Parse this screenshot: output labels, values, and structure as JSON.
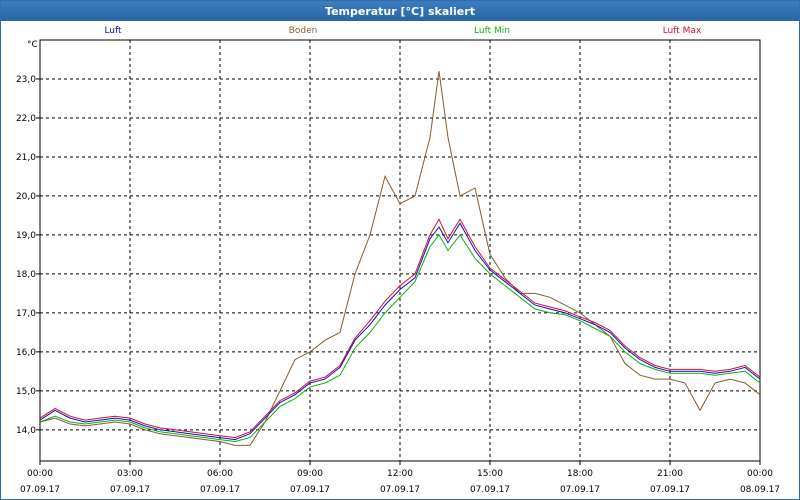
{
  "window": {
    "title": "Temperatur [°C] skaliert"
  },
  "chart_data": {
    "type": "line",
    "title": "Temperatur [°C] skaliert",
    "ylabel": "°C",
    "xlabel": "",
    "xlim": [
      0,
      24
    ],
    "ylim": [
      13.2,
      24.0
    ],
    "yticks": [
      14.0,
      15.0,
      16.0,
      17.0,
      18.0,
      19.0,
      20.0,
      21.0,
      22.0,
      23.0
    ],
    "ytick_labels": [
      "14,0",
      "15,0",
      "16,0",
      "17,0",
      "18,0",
      "19,0",
      "20,0",
      "21,0",
      "22,0",
      "23,0"
    ],
    "xticks": [
      {
        "t": 0,
        "time": "00:00",
        "date": "07.09.17"
      },
      {
        "t": 3,
        "time": "03:00",
        "date": "07.09.17"
      },
      {
        "t": 6,
        "time": "06:00",
        "date": "07.09.17"
      },
      {
        "t": 9,
        "time": "09:00",
        "date": "07.09.17"
      },
      {
        "t": 12,
        "time": "12:00",
        "date": "07.09.17"
      },
      {
        "t": 15,
        "time": "15:00",
        "date": "07.09.17"
      },
      {
        "t": 18,
        "time": "18:00",
        "date": "07.09.17"
      },
      {
        "t": 21,
        "time": "21:00",
        "date": "07.09.17"
      },
      {
        "t": 24,
        "time": "00:00",
        "date": "08.09.17"
      }
    ],
    "grid": true,
    "legend_position": "top",
    "series": [
      {
        "name": "Luft",
        "color": "#1010c0",
        "x": [
          0,
          0.5,
          1,
          1.5,
          2,
          2.5,
          3,
          3.5,
          4,
          4.5,
          5,
          5.5,
          6,
          6.5,
          7,
          7.5,
          8,
          8.5,
          9,
          9.5,
          10,
          10.5,
          11,
          11.5,
          12,
          12.5,
          13,
          13.3,
          13.6,
          14,
          14.5,
          15,
          15.5,
          16,
          16.5,
          17,
          17.5,
          18,
          18.5,
          19,
          19.5,
          20,
          20.5,
          21,
          21.5,
          22,
          22.5,
          23,
          23.5,
          24
        ],
        "y": [
          14.25,
          14.5,
          14.3,
          14.2,
          14.25,
          14.3,
          14.25,
          14.1,
          14.0,
          13.95,
          13.9,
          13.85,
          13.8,
          13.75,
          13.9,
          14.3,
          14.7,
          14.9,
          15.2,
          15.3,
          15.6,
          16.3,
          16.7,
          17.2,
          17.6,
          17.9,
          18.9,
          19.2,
          18.8,
          19.3,
          18.6,
          18.1,
          17.8,
          17.5,
          17.2,
          17.1,
          17.0,
          16.85,
          16.7,
          16.5,
          16.1,
          15.8,
          15.6,
          15.5,
          15.5,
          15.5,
          15.45,
          15.5,
          15.6,
          15.3
        ]
      },
      {
        "name": "Boden",
        "color": "#8b5a2b",
        "x": [
          0,
          0.5,
          1,
          1.5,
          2,
          2.5,
          3,
          3.5,
          4,
          4.5,
          5,
          5.5,
          6,
          6.5,
          7,
          7.5,
          8,
          8.5,
          9,
          9.5,
          10,
          10.5,
          11,
          11.5,
          12,
          12.5,
          13,
          13.3,
          13.6,
          14,
          14.5,
          15,
          15.5,
          16,
          16.5,
          17,
          17.5,
          18,
          18.5,
          19,
          19.5,
          20,
          20.5,
          21,
          21.5,
          22,
          22.5,
          23,
          23.5,
          24
        ],
        "y": [
          14.2,
          14.3,
          14.15,
          14.1,
          14.15,
          14.2,
          14.15,
          14.0,
          13.9,
          13.85,
          13.8,
          13.75,
          13.7,
          13.6,
          13.6,
          14.2,
          15.0,
          15.8,
          16.0,
          16.3,
          16.5,
          18.0,
          19.0,
          20.5,
          19.8,
          20.0,
          21.5,
          23.2,
          21.5,
          20.0,
          20.2,
          18.5,
          17.9,
          17.5,
          17.5,
          17.4,
          17.2,
          17.0,
          16.7,
          16.4,
          15.7,
          15.4,
          15.3,
          15.3,
          15.2,
          14.5,
          15.2,
          15.3,
          15.2,
          14.9
        ]
      },
      {
        "name": "Luft Min",
        "color": "#10b010",
        "x": [
          0,
          0.5,
          1,
          1.5,
          2,
          2.5,
          3,
          3.5,
          4,
          4.5,
          5,
          5.5,
          6,
          6.5,
          7,
          7.5,
          8,
          8.5,
          9,
          9.5,
          10,
          10.5,
          11,
          11.5,
          12,
          12.5,
          13,
          13.3,
          13.6,
          14,
          14.5,
          15,
          15.5,
          16,
          16.5,
          17,
          17.5,
          18,
          18.5,
          19,
          19.5,
          20,
          20.5,
          21,
          21.5,
          22,
          22.5,
          23,
          23.5,
          24
        ],
        "y": [
          14.2,
          14.35,
          14.2,
          14.15,
          14.2,
          14.25,
          14.2,
          14.05,
          13.95,
          13.9,
          13.85,
          13.8,
          13.75,
          13.7,
          13.8,
          14.2,
          14.6,
          14.8,
          15.1,
          15.2,
          15.4,
          16.1,
          16.5,
          17.0,
          17.4,
          17.8,
          18.7,
          19.0,
          18.6,
          19.0,
          18.4,
          18.0,
          17.7,
          17.4,
          17.1,
          17.0,
          16.95,
          16.8,
          16.6,
          16.4,
          16.0,
          15.7,
          15.55,
          15.45,
          15.45,
          15.45,
          15.4,
          15.45,
          15.5,
          15.2
        ]
      },
      {
        "name": "Luft Max",
        "color": "#d01030",
        "x": [
          0,
          0.5,
          1,
          1.5,
          2,
          2.5,
          3,
          3.5,
          4,
          4.5,
          5,
          5.5,
          6,
          6.5,
          7,
          7.5,
          8,
          8.5,
          9,
          9.5,
          10,
          10.5,
          11,
          11.5,
          12,
          12.5,
          13,
          13.3,
          13.6,
          14,
          14.5,
          15,
          15.5,
          16,
          16.5,
          17,
          17.5,
          18,
          18.5,
          19,
          19.5,
          20,
          20.5,
          21,
          21.5,
          22,
          22.5,
          23,
          23.5,
          24
        ],
        "y": [
          14.3,
          14.55,
          14.35,
          14.25,
          14.3,
          14.35,
          14.3,
          14.15,
          14.05,
          14.0,
          13.95,
          13.9,
          13.85,
          13.8,
          13.95,
          14.35,
          14.75,
          14.95,
          15.25,
          15.35,
          15.65,
          16.35,
          16.8,
          17.3,
          17.7,
          18.0,
          19.0,
          19.4,
          18.9,
          19.4,
          18.7,
          18.15,
          17.85,
          17.55,
          17.25,
          17.15,
          17.05,
          16.9,
          16.75,
          16.55,
          16.15,
          15.85,
          15.65,
          15.55,
          15.55,
          15.55,
          15.5,
          15.55,
          15.65,
          15.35
        ]
      }
    ]
  }
}
